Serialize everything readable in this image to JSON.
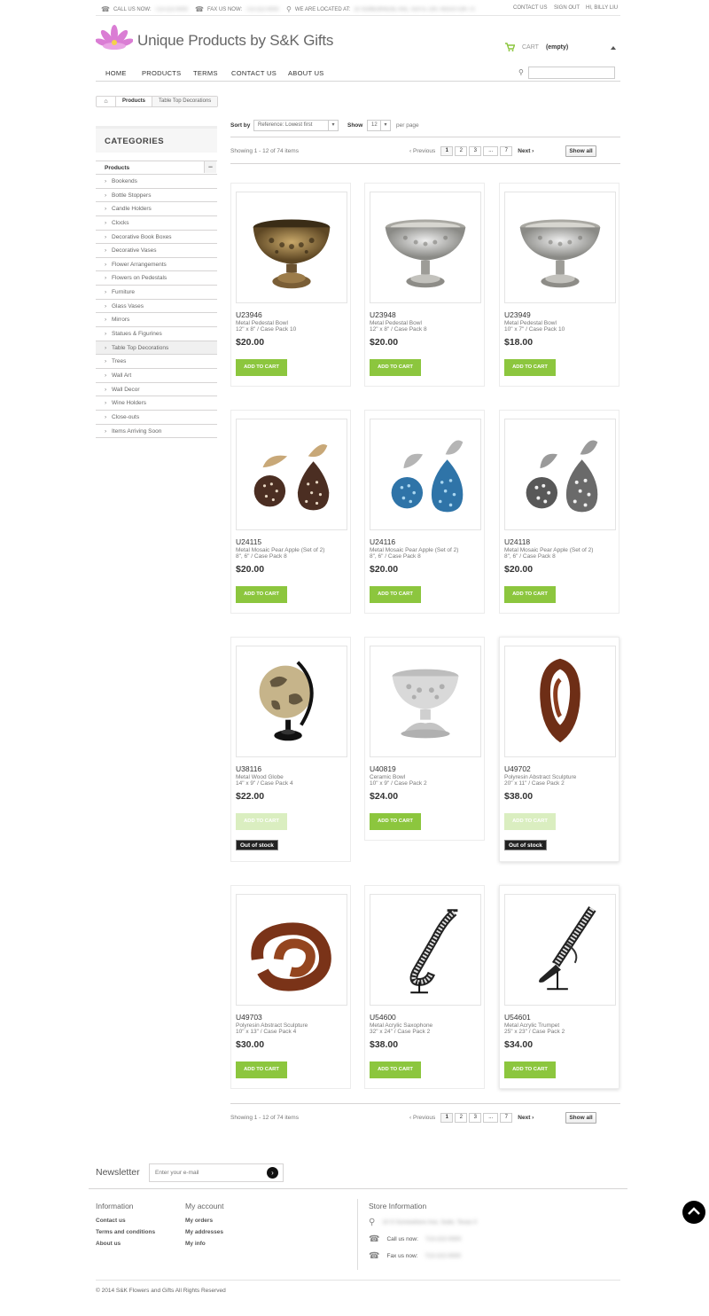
{
  "topbar": {
    "call_label": "CALL US NOW:",
    "call_value": "713-222-0000",
    "fax_label": "FAX US NOW:",
    "fax_value": "713-222-0000",
    "location_label": "WE ARE LOCATED AT:",
    "location_value": "10 SOMEWHERE AVE, SUITE 100, HOUSTON TX",
    "contact_us": "CONTACT US",
    "sign_out": "SIGN OUT",
    "greeting": "HI, BILLY LIU"
  },
  "header": {
    "logo_text": "Unique Products by S&K Gifts",
    "cart_label": "CART",
    "cart_status": "(empty)"
  },
  "nav": [
    "HOME",
    "PRODUCTS",
    "TERMS",
    "CONTACT US",
    "ABOUT US"
  ],
  "breadcrumb": {
    "home_icon": "home-icon",
    "parent": "Products",
    "current": "Table Top Decorations"
  },
  "categories": {
    "title": "CATEGORIES",
    "parent": "Products",
    "toggle": "−",
    "items": [
      "Bookends",
      "Bottle Stoppers",
      "Candle Holders",
      "Clocks",
      "Decorative Book Boxes",
      "Decorative Vases",
      "Flower Arrangements",
      "Flowers on Pedestals",
      "Furniture",
      "Glass Vases",
      "Mirrors",
      "Statues & Figurines",
      "Table Top Decorations",
      "Trees",
      "Wall Art",
      "Wall Decor",
      "Wine Holders",
      "Close-outs",
      "Items Arriving Soon"
    ],
    "active_index": 12
  },
  "sort": {
    "sort_label": "Sort by",
    "sort_value": "Reference: Lowest first",
    "show_label": "Show",
    "show_value": "12",
    "per_page": "per page"
  },
  "pagination": {
    "showing": "Showing 1 - 12 of 74 items",
    "previous": "Previous",
    "pages": [
      "1",
      "2",
      "3",
      "...",
      "7"
    ],
    "next": "Next",
    "show_all": "Show all"
  },
  "products": [
    {
      "ref": "U23946",
      "name": "Metal Pedestal Bowl",
      "size": "12\" x 8\" / Case Pack 10",
      "price": "$20.00",
      "button": "ADD TO CART",
      "in_stock": true,
      "art": "bowl-bronze"
    },
    {
      "ref": "U23948",
      "name": "Metal Pedestal Bowl",
      "size": "12\" x 8\" / Case Pack 8",
      "price": "$20.00",
      "button": "ADD TO CART",
      "in_stock": true,
      "art": "bowl-silver"
    },
    {
      "ref": "U23949",
      "name": "Metal Pedestal Bowl",
      "size": "10\" x 7\" / Case Pack 10",
      "price": "$18.00",
      "button": "ADD TO CART",
      "in_stock": true,
      "art": "bowl-silver"
    },
    {
      "ref": "U24115",
      "name": "Metal Mosaic Pear Apple (Set of 2)",
      "size": "8\", 6\" / Case Pack 8",
      "price": "$20.00",
      "button": "ADD TO CART",
      "in_stock": true,
      "art": "pear-brown"
    },
    {
      "ref": "U24116",
      "name": "Metal Mosaic Pear Apple (Set of 2)",
      "size": "8\", 6\" / Case Pack 8",
      "price": "$20.00",
      "button": "ADD TO CART",
      "in_stock": true,
      "art": "pear-blue"
    },
    {
      "ref": "U24118",
      "name": "Metal Mosaic Pear Apple (Set of 2)",
      "size": "8\", 6\" / Case Pack 8",
      "price": "$20.00",
      "button": "ADD TO CART",
      "in_stock": true,
      "art": "pear-silver"
    },
    {
      "ref": "U38116",
      "name": "Metal Wood Globe",
      "size": "14\" x 9\" / Case Pack 4",
      "price": "$22.00",
      "button": "ADD TO CART",
      "in_stock": false,
      "stock_label": "Out of stock",
      "art": "globe"
    },
    {
      "ref": "U40819",
      "name": "Ceramic Bowl",
      "size": "10\" x 9\" / Case Pack 2",
      "price": "$24.00",
      "button": "ADD TO CART",
      "in_stock": true,
      "art": "ceramic-bowl"
    },
    {
      "ref": "U49702",
      "name": "Polyresin Abstract Sculpture",
      "size": "20\" x 11\" / Case Pack 2",
      "price": "$38.00",
      "button": "ADD TO CART",
      "in_stock": false,
      "stock_label": "Out of stock",
      "art": "sculpture-tall"
    },
    {
      "ref": "U49703",
      "name": "Polyresin Abstract Sculpture",
      "size": "10\" x 13\" / Case Pack 4",
      "price": "$30.00",
      "button": "ADD TO CART",
      "in_stock": true,
      "art": "sculpture-knot"
    },
    {
      "ref": "U54600",
      "name": "Metal Acrylic Saxophone",
      "size": "32\" x 24\" / Case Pack 2",
      "price": "$38.00",
      "button": "ADD TO CART",
      "in_stock": true,
      "art": "saxophone"
    },
    {
      "ref": "U54601",
      "name": "Metal Acrylic Trumpet",
      "size": "25\" x 23\" / Case Pack 2",
      "price": "$34.00",
      "button": "ADD TO CART",
      "in_stock": true,
      "art": "trumpet"
    }
  ],
  "footer": {
    "newsletter_title": "Newsletter",
    "newsletter_placeholder": "Enter your e-mail",
    "information_title": "Information",
    "information_links": [
      "Contact us",
      "Terms and conditions",
      "About us"
    ],
    "account_title": "My account",
    "account_links": [
      "My orders",
      "My addresses",
      "My info"
    ],
    "store_title": "Store Information",
    "store_address": "10 S Somewhere Ave, Suite, Texas 0",
    "call_label": "Call us now:",
    "call_value": "713-222-0000",
    "fax_label": "Fax us now:",
    "fax_value": "713-222-0000",
    "copyright": "© 2014 S&K Flowers and Gifts All Rights Reserved"
  },
  "colors": {
    "accent": "#8cc63e",
    "accent_disabled": "#daeec0",
    "logo_pink": "#d66fd0"
  }
}
